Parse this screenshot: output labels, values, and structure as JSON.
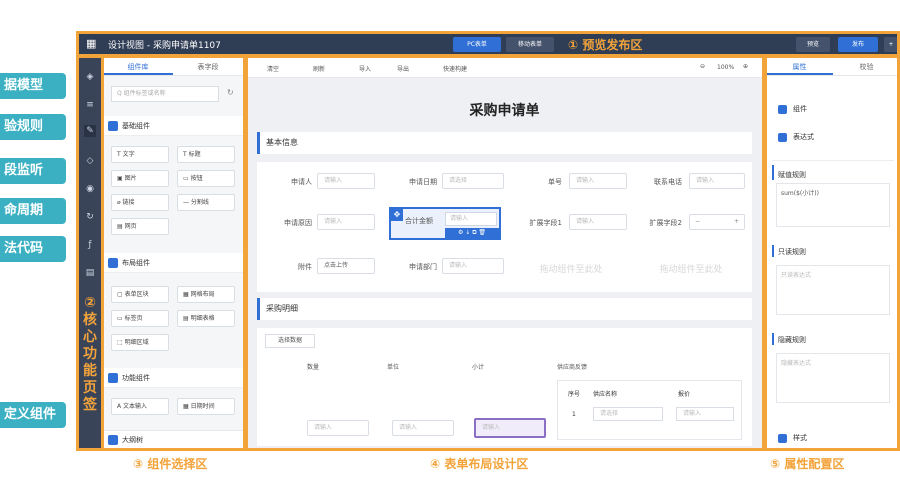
{
  "callouts": [
    "据模型",
    "验规则",
    "段监听",
    "命周期",
    "法代码",
    "定义组件"
  ],
  "core_label": {
    "num": "②",
    "chars": [
      "核",
      "心",
      "功",
      "能",
      "页",
      "签"
    ]
  },
  "topbar": {
    "title": "设计视图 - 采购申请单1107",
    "pc_label": "PC表单",
    "mobile_label": "移动表单",
    "preview_label": "预览",
    "publish_label": "发布",
    "region_label": "① 预览发布区"
  },
  "left_panel": {
    "tabs": [
      "组件库",
      "表字段"
    ],
    "search_placeholder": "Q 组件标签或名称",
    "groups": [
      {
        "title": "基础组件",
        "items": [
          "T 文字",
          "T 标题",
          "▣ 图片",
          "▭ 按钮",
          "⌀ 链接",
          "— 分割线",
          "▤ 网页"
        ]
      },
      {
        "title": "布局组件",
        "items": [
          "▢ 表单区块",
          "▦ 网格布局",
          "▭ 标签页",
          "▤ 明细表格",
          "⬚ 明细区域"
        ]
      },
      {
        "title": "功能组件",
        "items": [
          "A 文本输入",
          "▦ 日期时间"
        ]
      }
    ],
    "outline_label": "大纲树"
  },
  "toolbar": {
    "items": [
      "清空",
      "刷新",
      "导入",
      "导出",
      "快速构建"
    ],
    "zoom": "100%"
  },
  "form": {
    "title": "采购申请单",
    "section1": "基本信息",
    "fields": [
      {
        "label": "申请人",
        "placeholder": "请输入"
      },
      {
        "label": "申请日期",
        "placeholder": "请选择"
      },
      {
        "label": "单号",
        "placeholder": "请输入"
      },
      {
        "label": "联系电话",
        "placeholder": "请输入"
      },
      {
        "label": "申请原因",
        "placeholder": "请输入"
      },
      {
        "label": "合计金额",
        "placeholder": "请输入"
      },
      {
        "label": "扩展字段1",
        "placeholder": "请输入"
      },
      {
        "label": "扩展字段2",
        "placeholder": ""
      },
      {
        "label": "附件",
        "placeholder": "点击上传"
      },
      {
        "label": "申请部门",
        "placeholder": "请输入"
      }
    ],
    "drop_text": "拖动组件至此处",
    "section2": "采购明细",
    "select_data": "选择数据",
    "detail_headers": [
      "数量",
      "单位",
      "小计",
      "供应商反馈"
    ],
    "sub_headers": [
      "序号",
      "供应名称",
      "报价"
    ],
    "sub_row": {
      "index": "1",
      "select": "请选择",
      "input": "请输入"
    },
    "row_inputs": [
      "请输入",
      "请输入",
      "请输入"
    ]
  },
  "right_panel": {
    "tabs": [
      "属性",
      "校验"
    ],
    "items_top": [
      "组件",
      "表达式"
    ],
    "rule1": "赋值规则",
    "rule1_value": "sum($(小计))",
    "rule2": "只读规则",
    "rule2_placeholder": "只读表达式",
    "rule3": "隐藏规则",
    "rule3_placeholder": "隐藏表达式",
    "style_label": "样式"
  },
  "region_labels": [
    "③ 组件选择区",
    "④ 表单布局设计区",
    "⑤ 属性配置区"
  ]
}
